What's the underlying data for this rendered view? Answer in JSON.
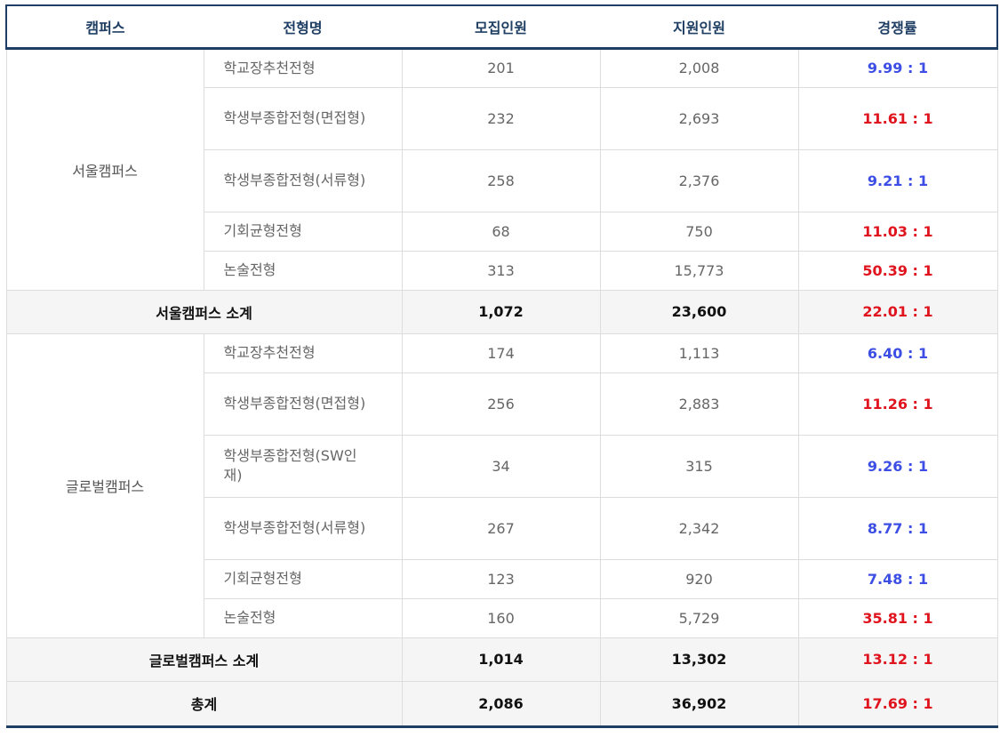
{
  "header": {
    "campus": "캠퍼스",
    "track": "전형명",
    "quota": "모집인원",
    "applicants": "지원인원",
    "ratio": "경쟁률"
  },
  "seoul": {
    "campus_name": "서울캠퍼스",
    "rows": [
      {
        "name": "학교장추천전형",
        "quota": "201",
        "applicants": "2,008",
        "ratio": "9.99 : 1",
        "ratio_color": "#3c4ee4"
      },
      {
        "name": "학생부종합전형(면접형)",
        "quota": "232",
        "applicants": "2,693",
        "ratio": "11.61 : 1",
        "ratio_color": "#e0141e"
      },
      {
        "name": "학생부종합전형(서류형)",
        "quota": "258",
        "applicants": "2,376",
        "ratio": "9.21 : 1",
        "ratio_color": "#3c4ee4"
      },
      {
        "name": "기회균형전형",
        "quota": "68",
        "applicants": "750",
        "ratio": "11.03 : 1",
        "ratio_color": "#e0141e"
      },
      {
        "name": "논술전형",
        "quota": "313",
        "applicants": "15,773",
        "ratio": "50.39 : 1",
        "ratio_color": "#e0141e"
      }
    ],
    "subtotal": {
      "label": "서울캠퍼스 소계",
      "quota": "1,072",
      "applicants": "23,600",
      "ratio": "22.01 : 1"
    }
  },
  "global": {
    "campus_name": "글로벌캠퍼스",
    "rows": [
      {
        "name": "학교장추천전형",
        "quota": "174",
        "applicants": "1,113",
        "ratio": "6.40 : 1",
        "ratio_color": "#3c4ee4"
      },
      {
        "name": "학생부종합전형(면접형)",
        "quota": "256",
        "applicants": "2,883",
        "ratio": "11.26 : 1",
        "ratio_color": "#e0141e"
      },
      {
        "name": "학생부종합전형(SW인재)",
        "quota": "34",
        "applicants": "315",
        "ratio": "9.26 : 1",
        "ratio_color": "#3c4ee4"
      },
      {
        "name": "학생부종합전형(서류형)",
        "quota": "267",
        "applicants": "2,342",
        "ratio": "8.77 : 1",
        "ratio_color": "#3c4ee4"
      },
      {
        "name": "기회균형전형",
        "quota": "123",
        "applicants": "920",
        "ratio": "7.48 : 1",
        "ratio_color": "#3c4ee4"
      },
      {
        "name": "논술전형",
        "quota": "160",
        "applicants": "5,729",
        "ratio": "35.81 : 1",
        "ratio_color": "#e0141e"
      }
    ],
    "subtotal": {
      "label": "글로벌캠퍼스 소계",
      "quota": "1,014",
      "applicants": "13,302",
      "ratio": "13.12 : 1"
    }
  },
  "total": {
    "label": "총계",
    "quota": "2,086",
    "applicants": "36,902",
    "ratio": "17.69 : 1"
  }
}
